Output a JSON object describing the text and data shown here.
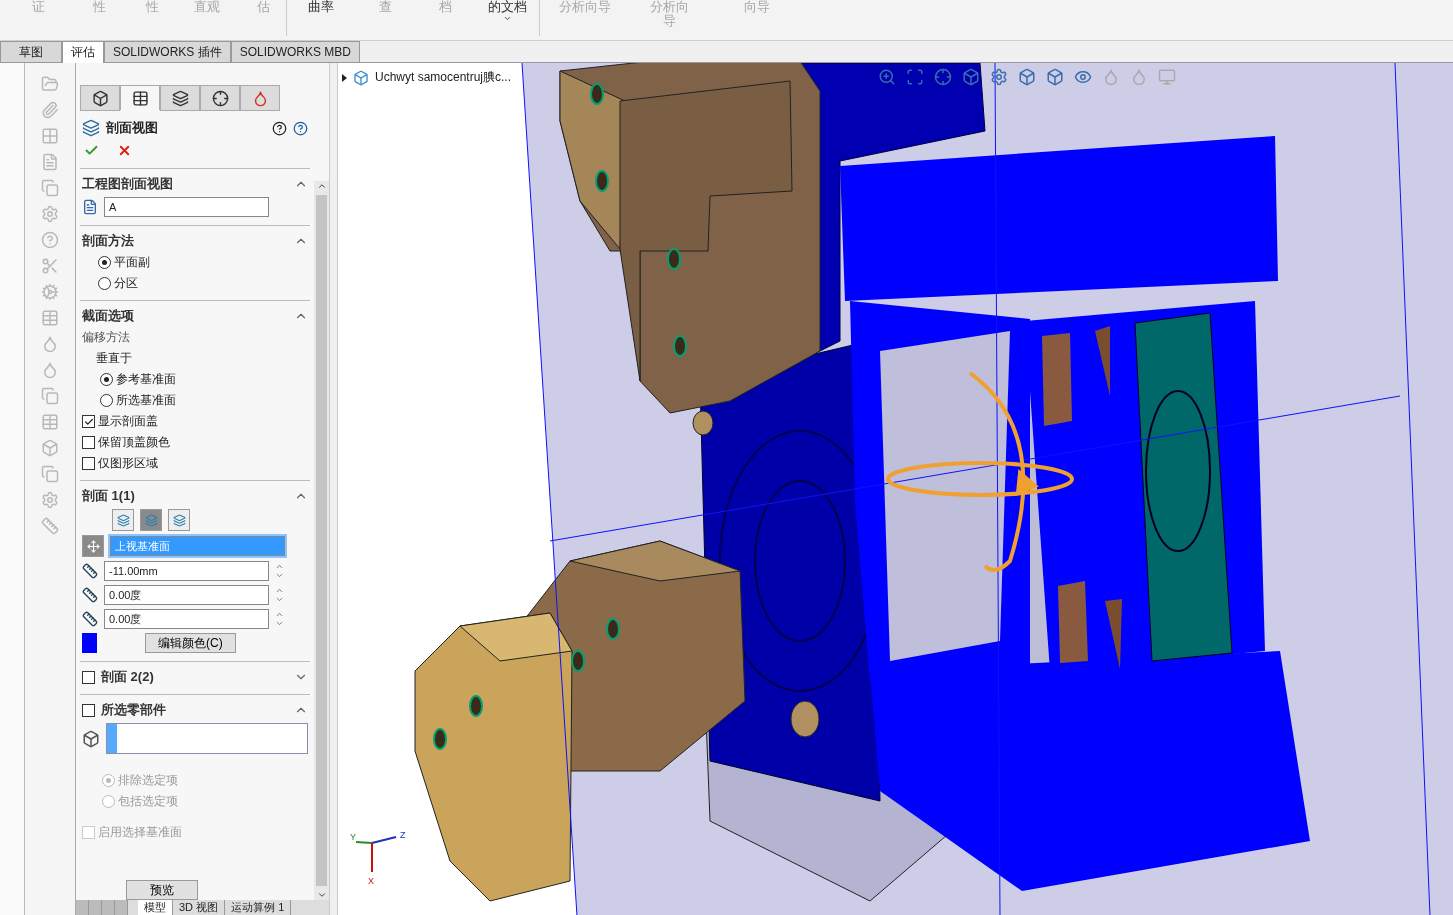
{
  "ribbon": {
    "items": [
      {
        "lines": [
          "证"
        ],
        "disabled": true
      },
      {
        "lines": [
          "性"
        ],
        "disabled": true
      },
      {
        "lines": [
          "性"
        ],
        "disabled": true
      },
      {
        "lines": [
          "直观"
        ],
        "disabled": true
      },
      {
        "lines": [
          "估"
        ],
        "disabled": true
      },
      {
        "lines": [
          "曲率"
        ],
        "disabled": false
      },
      {
        "lines": [
          "查"
        ],
        "disabled": true
      },
      {
        "lines": [
          "档"
        ],
        "disabled": true
      },
      {
        "lines": [
          "的文档"
        ],
        "disabled": false,
        "dropdown": true
      },
      {
        "lines": [
          "分析向导"
        ],
        "disabled": true
      },
      {
        "lines": [
          "分析向",
          "导"
        ],
        "disabled": true
      },
      {
        "lines": [
          "向导"
        ],
        "disabled": true
      }
    ]
  },
  "command_tabs": [
    {
      "label": "草图",
      "selected": false
    },
    {
      "label": "评估",
      "selected": true
    },
    {
      "label": "SOLIDWORKS 插件",
      "selected": false
    },
    {
      "label": "SOLIDWORKS MBD",
      "selected": false
    }
  ],
  "property_manager": {
    "tabs": [
      {
        "selected": false
      },
      {
        "selected": true
      },
      {
        "selected": false
      },
      {
        "selected": false
      },
      {
        "selected": false
      }
    ],
    "title": "剖面视图",
    "sections": [
      {
        "kind": "label",
        "title": "工程图剖面视图",
        "expanded": true,
        "value": "A"
      },
      {
        "kind": "method",
        "title": "剖面方法",
        "expanded": true,
        "options": [
          {
            "label": "平面副",
            "selected": true
          },
          {
            "label": "分区",
            "selected": false
          }
        ]
      },
      {
        "kind": "options",
        "title": "截面选项",
        "expanded": true,
        "offset_label": "偏移方法",
        "normal_label": "垂直于",
        "options": [
          {
            "label": "参考基准面",
            "selected": true
          },
          {
            "label": "所选基准面",
            "selected": false
          }
        ],
        "checks": [
          {
            "label": "显示剖面盖",
            "checked": true
          },
          {
            "label": "保留顶盖颜色",
            "checked": false
          },
          {
            "label": "仅图形区域",
            "checked": false
          }
        ]
      },
      {
        "kind": "section",
        "title": "**剖面** 1(1)",
        "expanded": true,
        "planes": [
          {
            "selected": false
          },
          {
            "selected": true
          },
          {
            "selected": false
          }
        ],
        "reference": "上视基准面",
        "offset": "-11.00mm",
        "angle_x": "0.00度",
        "angle_y": "0.00度",
        "color": "#0000ff",
        "color_button": "编辑颜色(C)"
      },
      {
        "kind": "toggle",
        "title": "**剖面** 2(2)",
        "checked": false,
        "expanded": false
      },
      {
        "kind": "components",
        "title": "所选零部件",
        "checked": false,
        "expanded": true,
        "options": [
          {
            "label": "排除选定项",
            "selected": true
          },
          {
            "label": "包括选定项",
            "selected": false
          }
        ],
        "plane_check": {
          "label": "启用选择基准面",
          "checked": false
        }
      }
    ],
    "preview_button": "预览"
  },
  "bottom_tabs": [
    {
      "label": "模型",
      "selected": true
    },
    {
      "label": "3D 视图",
      "selected": false
    },
    {
      "label": "运动算例 1",
      "selected": false
    }
  ],
  "feature_tree": {
    "root": "Uchwyt samocentruj腆c..."
  },
  "triad": {
    "axes": [
      "Y",
      "Z",
      "X"
    ]
  }
}
